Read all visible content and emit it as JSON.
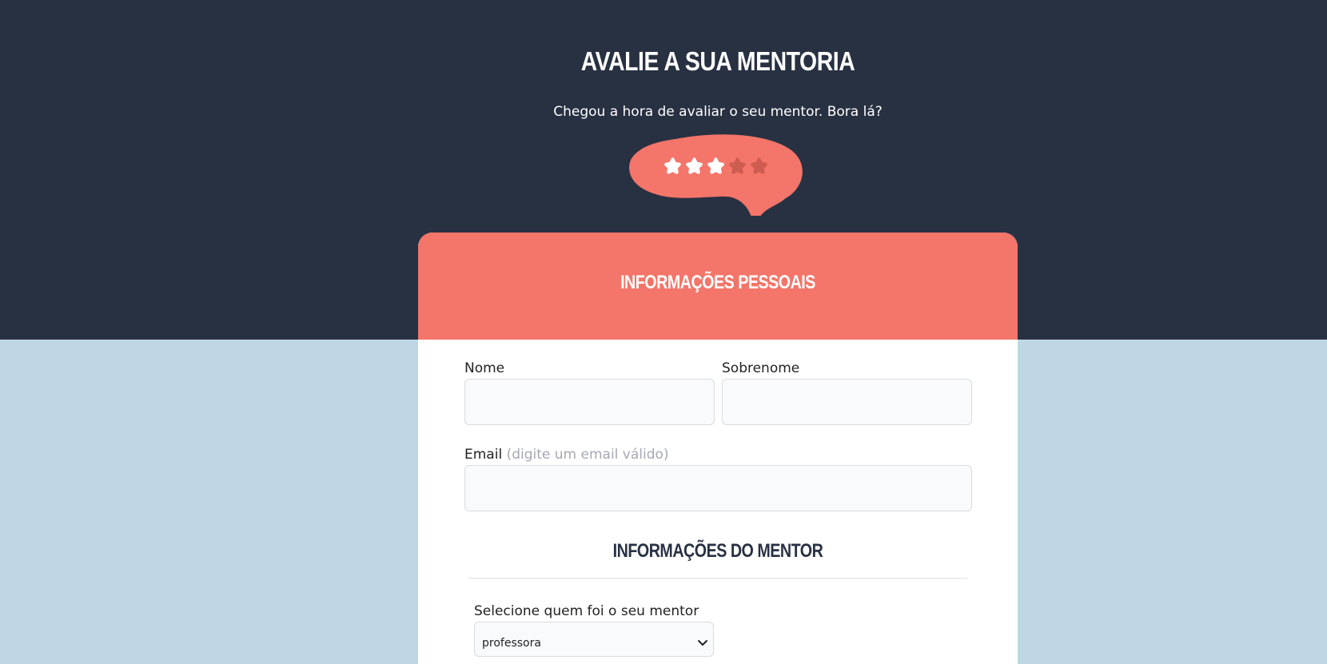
{
  "page": {
    "title": "AVALIE A SUA MENTORIA",
    "subtitle": "Chegou a hora de avaliar o seu mentor. Bora lá?"
  },
  "rating": {
    "value": 3,
    "max": 5
  },
  "colors": {
    "dark_bg": "#283142",
    "light_bg": "#bfd7e4",
    "accent": "#f47569",
    "star_active": "#ffffff",
    "star_inactive": "#cf5c50"
  },
  "personal_section": {
    "title": "INFORMAÇÕES PESSOAIS",
    "first_name_label": "Nome",
    "first_name_value": "",
    "last_name_label": "Sobrenome",
    "last_name_value": "",
    "email_label": "Email",
    "email_hint": "(digite um email válido)",
    "email_value": ""
  },
  "mentor_section": {
    "title": "INFORMAÇÕES DO MENTOR",
    "select_label": "Selecione quem foi o seu mentor",
    "select_value": "professora"
  },
  "icons": {
    "star": "star-icon",
    "bubble": "speech-bubble",
    "chevron": "chevron-down-icon"
  }
}
